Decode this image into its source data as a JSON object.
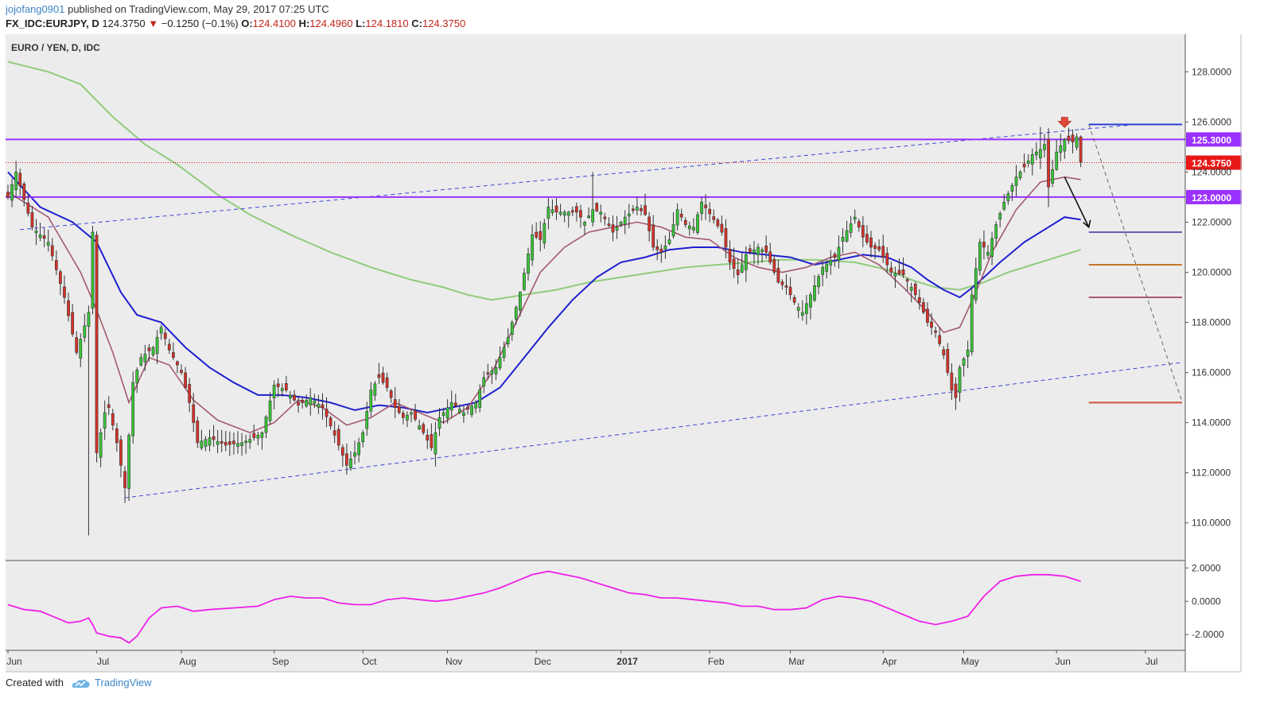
{
  "header": {
    "author": "jojofang0901",
    "published": "published on TradingView.com, May 29, 2017 07:25 UTC",
    "symbol": "FX_IDC:EURJPY, D",
    "last": "124.3750",
    "change_arrow": "▼",
    "change": "−0.1250 (−0.1%)",
    "o_label": "O:",
    "o": "124.4100",
    "h_label": "H:",
    "h": "124.4960",
    "l_label": "L:",
    "l": "124.1810",
    "c_label": "C:",
    "c": "124.3750"
  },
  "footer": {
    "created_with": "Created with",
    "brand": "TradingView"
  },
  "colors": {
    "background": "#ececec",
    "up": "#37c837",
    "down": "#d83228",
    "ma_fast": "#a35a6e",
    "ma_mid": "#2020d0",
    "ma_slow": "#8fcb7c",
    "level": "#9b30ff",
    "osc": "#ee20e8",
    "last_price": "#e81818"
  },
  "chart_data": {
    "type": "candlestick",
    "title": "EURO / YEN, D, IDC",
    "y_ticks": [
      "110.0000",
      "112.0000",
      "114.0000",
      "116.0000",
      "118.0000",
      "120.0000",
      "122.0000",
      "124.0000",
      "126.0000",
      "128.0000"
    ],
    "y_range": [
      108.5,
      129.5
    ],
    "x_labels": [
      {
        "label": "Jun",
        "idx": 0
      },
      {
        "label": "Jul",
        "idx": 22
      },
      {
        "label": "Aug",
        "idx": 43
      },
      {
        "label": "Sep",
        "idx": 66
      },
      {
        "label": "Oct",
        "idx": 88
      },
      {
        "label": "Nov",
        "idx": 109
      },
      {
        "label": "Dec",
        "idx": 131
      },
      {
        "label": "2017",
        "idx": 152,
        "bold": true
      },
      {
        "label": "Feb",
        "idx": 174
      },
      {
        "label": "Mar",
        "idx": 194
      },
      {
        "label": "Apr",
        "idx": 217
      },
      {
        "label": "May",
        "idx": 237
      },
      {
        "label": "Jun",
        "idx": 260
      },
      {
        "label": "Jul",
        "idx": 282
      }
    ],
    "close_anchors": [
      [
        0,
        123.0
      ],
      [
        2,
        124.0
      ],
      [
        6,
        121.8
      ],
      [
        10,
        121.2
      ],
      [
        14,
        119.0
      ],
      [
        17,
        116.8
      ],
      [
        20,
        118.4
      ],
      [
        21,
        121.6
      ],
      [
        22,
        112.8
      ],
      [
        24,
        114.4
      ],
      [
        25,
        114.6
      ],
      [
        27,
        113.2
      ],
      [
        29,
        111.4
      ],
      [
        31,
        115.6
      ],
      [
        33,
        116.6
      ],
      [
        36,
        117.0
      ],
      [
        38,
        117.8
      ],
      [
        40,
        116.9
      ],
      [
        43,
        116.0
      ],
      [
        45,
        114.8
      ],
      [
        47,
        113.2
      ],
      [
        50,
        113.4
      ],
      [
        54,
        113.1
      ],
      [
        58,
        113.2
      ],
      [
        61,
        113.4
      ],
      [
        63,
        113.6
      ],
      [
        66,
        115.5
      ],
      [
        69,
        115.3
      ],
      [
        72,
        114.7
      ],
      [
        75,
        115.0
      ],
      [
        78,
        114.6
      ],
      [
        81,
        113.5
      ],
      [
        84,
        112.3
      ],
      [
        86,
        112.8
      ],
      [
        88,
        113.6
      ],
      [
        90,
        115.3
      ],
      [
        92,
        115.8
      ],
      [
        94,
        115.4
      ],
      [
        96,
        114.6
      ],
      [
        98,
        114.2
      ],
      [
        100,
        114.4
      ],
      [
        103,
        113.6
      ],
      [
        105,
        113.0
      ],
      [
        107,
        114.2
      ],
      [
        110,
        114.8
      ],
      [
        113,
        114.4
      ],
      [
        116,
        114.8
      ],
      [
        118,
        115.8
      ],
      [
        121,
        116.2
      ],
      [
        124,
        117.4
      ],
      [
        127,
        119.2
      ],
      [
        130,
        121.5
      ],
      [
        132,
        121.3
      ],
      [
        134,
        122.6
      ],
      [
        136,
        122.4
      ],
      [
        139,
        122.4
      ],
      [
        141,
        122.4
      ],
      [
        143,
        122.0
      ],
      [
        145,
        122.5
      ],
      [
        147,
        122.4
      ],
      [
        150,
        121.6
      ],
      [
        153,
        122.2
      ],
      [
        156,
        122.6
      ],
      [
        158,
        122.3
      ],
      [
        160,
        121.0
      ],
      [
        162,
        120.8
      ],
      [
        164,
        121.3
      ],
      [
        166,
        122.5
      ],
      [
        168,
        121.9
      ],
      [
        170,
        121.8
      ],
      [
        172,
        122.8
      ],
      [
        175,
        122.1
      ],
      [
        177,
        121.6
      ],
      [
        179,
        120.4
      ],
      [
        181,
        119.9
      ],
      [
        183,
        120.7
      ],
      [
        186,
        121.0
      ],
      [
        188,
        120.8
      ],
      [
        191,
        119.6
      ],
      [
        193,
        119.4
      ],
      [
        195,
        118.8
      ],
      [
        197,
        118.4
      ],
      [
        199,
        119.1
      ],
      [
        202,
        120.2
      ],
      [
        205,
        120.6
      ],
      [
        207,
        121.4
      ],
      [
        210,
        122.2
      ],
      [
        212,
        121.4
      ],
      [
        214,
        121.0
      ],
      [
        216,
        120.9
      ],
      [
        219,
        120.0
      ],
      [
        222,
        119.9
      ],
      [
        224,
        119.4
      ],
      [
        226,
        118.8
      ],
      [
        228,
        118.0
      ],
      [
        230,
        117.6
      ],
      [
        232,
        116.7
      ],
      [
        234,
        115.3
      ],
      [
        235,
        115.0
      ],
      [
        236,
        116.2
      ],
      [
        238,
        116.9
      ],
      [
        239,
        119.1
      ],
      [
        241,
        121.2
      ],
      [
        243,
        120.8
      ],
      [
        245,
        121.9
      ],
      [
        247,
        122.8
      ],
      [
        250,
        123.8
      ],
      [
        252,
        124.2
      ],
      [
        254,
        124.7
      ],
      [
        256,
        124.9
      ],
      [
        257,
        125.1
      ],
      [
        258,
        123.4
      ],
      [
        260,
        124.8
      ],
      [
        262,
        125.3
      ],
      [
        264,
        125.2
      ],
      [
        265,
        125.4
      ],
      [
        266,
        124.4
      ]
    ],
    "wick_extremes": [
      {
        "idx": 20,
        "low": 109.5
      },
      {
        "idx": 29,
        "low": 110.8
      },
      {
        "idx": 234,
        "low": 114.9
      },
      {
        "idx": 258,
        "low": 122.6
      },
      {
        "idx": 256,
        "high": 125.8
      },
      {
        "idx": 264,
        "high": 125.7
      },
      {
        "idx": 145,
        "high": 124.0
      }
    ],
    "moving_averages": {
      "ma_fast": [
        [
          0,
          123.2
        ],
        [
          10,
          122.2
        ],
        [
          18,
          120.0
        ],
        [
          22,
          118.5
        ],
        [
          26,
          116.8
        ],
        [
          30,
          114.8
        ],
        [
          35,
          116.6
        ],
        [
          40,
          116.3
        ],
        [
          46,
          114.9
        ],
        [
          52,
          114.1
        ],
        [
          60,
          113.6
        ],
        [
          66,
          114.0
        ],
        [
          72,
          114.9
        ],
        [
          78,
          114.6
        ],
        [
          84,
          113.9
        ],
        [
          90,
          114.2
        ],
        [
          96,
          114.8
        ],
        [
          102,
          114.4
        ],
        [
          108,
          114.0
        ],
        [
          114,
          114.6
        ],
        [
          120,
          116.0
        ],
        [
          126,
          118.0
        ],
        [
          132,
          120.0
        ],
        [
          138,
          121.0
        ],
        [
          144,
          121.6
        ],
        [
          150,
          121.8
        ],
        [
          156,
          122.0
        ],
        [
          162,
          121.8
        ],
        [
          168,
          121.4
        ],
        [
          174,
          121.3
        ],
        [
          180,
          120.6
        ],
        [
          186,
          120.2
        ],
        [
          192,
          120.0
        ],
        [
          198,
          120.2
        ],
        [
          204,
          120.6
        ],
        [
          210,
          120.8
        ],
        [
          216,
          120.3
        ],
        [
          222,
          119.4
        ],
        [
          228,
          118.4
        ],
        [
          232,
          117.6
        ],
        [
          236,
          117.8
        ],
        [
          240,
          119.2
        ],
        [
          244,
          120.8
        ],
        [
          250,
          122.5
        ],
        [
          256,
          123.6
        ],
        [
          262,
          123.8
        ],
        [
          266,
          123.7
        ]
      ],
      "ma_mid": [
        [
          0,
          124.0
        ],
        [
          8,
          122.6
        ],
        [
          16,
          122.0
        ],
        [
          22,
          121.2
        ],
        [
          28,
          119.2
        ],
        [
          32,
          118.3
        ],
        [
          38,
          118.0
        ],
        [
          44,
          117.0
        ],
        [
          50,
          116.2
        ],
        [
          56,
          115.6
        ],
        [
          62,
          115.1
        ],
        [
          68,
          115.1
        ],
        [
          74,
          115.0
        ],
        [
          80,
          114.8
        ],
        [
          86,
          114.5
        ],
        [
          92,
          114.7
        ],
        [
          98,
          114.6
        ],
        [
          104,
          114.4
        ],
        [
          110,
          114.6
        ],
        [
          116,
          114.8
        ],
        [
          122,
          115.4
        ],
        [
          128,
          116.6
        ],
        [
          134,
          117.8
        ],
        [
          140,
          118.9
        ],
        [
          146,
          119.8
        ],
        [
          152,
          120.4
        ],
        [
          158,
          120.6
        ],
        [
          164,
          120.9
        ],
        [
          170,
          121.0
        ],
        [
          176,
          121.0
        ],
        [
          182,
          120.8
        ],
        [
          188,
          120.7
        ],
        [
          194,
          120.6
        ],
        [
          200,
          120.3
        ],
        [
          206,
          120.5
        ],
        [
          212,
          120.7
        ],
        [
          218,
          120.6
        ],
        [
          224,
          120.2
        ],
        [
          228,
          119.7
        ],
        [
          232,
          119.3
        ],
        [
          236,
          119.0
        ],
        [
          240,
          119.5
        ],
        [
          246,
          120.4
        ],
        [
          252,
          121.2
        ],
        [
          258,
          121.8
        ],
        [
          262,
          122.2
        ],
        [
          266,
          122.1
        ]
      ],
      "ma_slow": [
        [
          0,
          128.4
        ],
        [
          10,
          128.0
        ],
        [
          18,
          127.5
        ],
        [
          26,
          126.2
        ],
        [
          34,
          125.1
        ],
        [
          42,
          124.3
        ],
        [
          52,
          123.1
        ],
        [
          60,
          122.3
        ],
        [
          70,
          121.5
        ],
        [
          80,
          120.8
        ],
        [
          90,
          120.2
        ],
        [
          100,
          119.7
        ],
        [
          108,
          119.4
        ],
        [
          114,
          119.1
        ],
        [
          120,
          118.9
        ],
        [
          128,
          119.1
        ],
        [
          136,
          119.3
        ],
        [
          144,
          119.6
        ],
        [
          152,
          119.8
        ],
        [
          160,
          120.0
        ],
        [
          168,
          120.2
        ],
        [
          176,
          120.3
        ],
        [
          184,
          120.4
        ],
        [
          192,
          120.5
        ],
        [
          200,
          120.5
        ],
        [
          210,
          120.4
        ],
        [
          218,
          120.1
        ],
        [
          224,
          119.7
        ],
        [
          230,
          119.4
        ],
        [
          236,
          119.3
        ],
        [
          242,
          119.6
        ],
        [
          248,
          120.0
        ],
        [
          254,
          120.3
        ],
        [
          260,
          120.6
        ],
        [
          266,
          120.9
        ]
      ]
    },
    "horizontal_levels": [
      {
        "price": 125.3,
        "label": "125.3000"
      },
      {
        "price": 123.0,
        "label": "123.0000"
      }
    ],
    "last_price": {
      "price": 124.375,
      "label": "124.3750"
    },
    "target_levels": [
      {
        "price": 125.9,
        "color": "#2b3fd6"
      },
      {
        "price": 121.6,
        "color": "#6a5fb0"
      },
      {
        "price": 120.3,
        "color": "#c8752a"
      },
      {
        "price": 119.0,
        "color": "#a8587a"
      },
      {
        "price": 114.8,
        "color": "#d0503c"
      }
    ],
    "trend_lines": [
      {
        "from": [
          3,
          121.7
        ],
        "to": [
          266,
          125.7
        ],
        "style": "dashed",
        "color": "#3c46d6"
      },
      {
        "from": [
          29,
          111.0
        ],
        "to": [
          291,
          116.4
        ],
        "style": "dashed",
        "color": "#3c46d6"
      },
      {
        "from": [
          266,
          125.7
        ],
        "to": [
          280,
          125.9
        ],
        "style": "dashed",
        "color": "#3c46d6"
      }
    ],
    "oscillator": {
      "y_ticks": [
        "2.0000",
        "0.0000",
        "-2.0000"
      ],
      "y_range": [
        -2.9,
        2.4
      ],
      "points": [
        [
          0,
          -0.2
        ],
        [
          4,
          -0.5
        ],
        [
          8,
          -0.6
        ],
        [
          12,
          -1.0
        ],
        [
          15,
          -1.3
        ],
        [
          18,
          -1.2
        ],
        [
          20,
          -1.0
        ],
        [
          21,
          -1.4
        ],
        [
          22,
          -1.9
        ],
        [
          25,
          -2.1
        ],
        [
          28,
          -2.2
        ],
        [
          30,
          -2.5
        ],
        [
          32,
          -2.1
        ],
        [
          35,
          -1.0
        ],
        [
          38,
          -0.4
        ],
        [
          42,
          -0.3
        ],
        [
          46,
          -0.6
        ],
        [
          50,
          -0.5
        ],
        [
          56,
          -0.4
        ],
        [
          62,
          -0.3
        ],
        [
          66,
          0.1
        ],
        [
          70,
          0.3
        ],
        [
          74,
          0.2
        ],
        [
          78,
          0.2
        ],
        [
          82,
          -0.1
        ],
        [
          86,
          -0.2
        ],
        [
          90,
          -0.2
        ],
        [
          94,
          0.1
        ],
        [
          98,
          0.2
        ],
        [
          102,
          0.1
        ],
        [
          106,
          0.0
        ],
        [
          110,
          0.1
        ],
        [
          114,
          0.3
        ],
        [
          118,
          0.5
        ],
        [
          122,
          0.8
        ],
        [
          126,
          1.2
        ],
        [
          130,
          1.6
        ],
        [
          134,
          1.8
        ],
        [
          138,
          1.6
        ],
        [
          142,
          1.4
        ],
        [
          146,
          1.1
        ],
        [
          150,
          0.8
        ],
        [
          154,
          0.5
        ],
        [
          158,
          0.4
        ],
        [
          162,
          0.2
        ],
        [
          166,
          0.2
        ],
        [
          170,
          0.1
        ],
        [
          174,
          0.0
        ],
        [
          178,
          -0.1
        ],
        [
          182,
          -0.3
        ],
        [
          186,
          -0.3
        ],
        [
          190,
          -0.5
        ],
        [
          194,
          -0.5
        ],
        [
          198,
          -0.4
        ],
        [
          202,
          0.1
        ],
        [
          206,
          0.3
        ],
        [
          210,
          0.2
        ],
        [
          214,
          0.0
        ],
        [
          218,
          -0.4
        ],
        [
          222,
          -0.8
        ],
        [
          226,
          -1.2
        ],
        [
          230,
          -1.4
        ],
        [
          234,
          -1.2
        ],
        [
          238,
          -0.9
        ],
        [
          242,
          0.3
        ],
        [
          246,
          1.2
        ],
        [
          250,
          1.5
        ],
        [
          254,
          1.6
        ],
        [
          258,
          1.6
        ],
        [
          262,
          1.5
        ],
        [
          266,
          1.2
        ]
      ]
    }
  }
}
